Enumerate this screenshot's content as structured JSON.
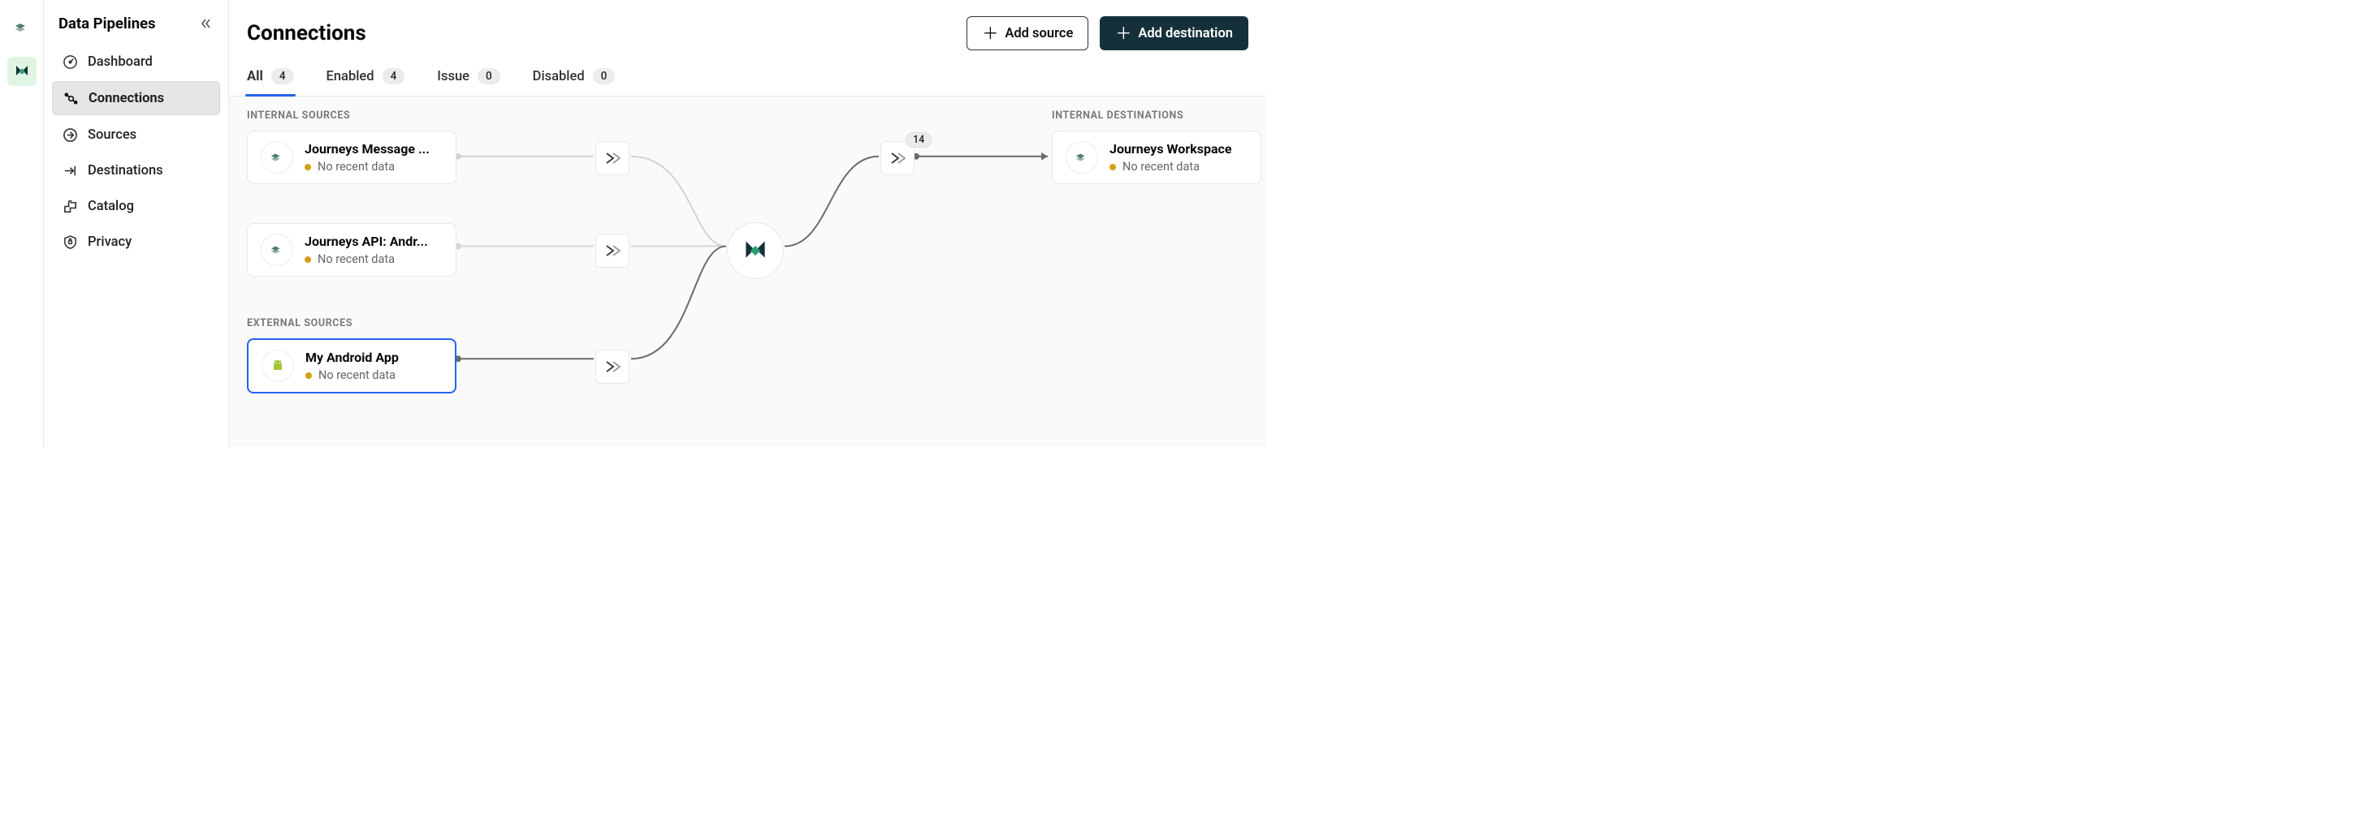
{
  "sidebar": {
    "title": "Data Pipelines",
    "nav": [
      {
        "label": "Dashboard"
      },
      {
        "label": "Connections"
      },
      {
        "label": "Sources"
      },
      {
        "label": "Destinations"
      },
      {
        "label": "Catalog"
      },
      {
        "label": "Privacy"
      }
    ]
  },
  "header": {
    "title": "Connections",
    "add_source": "Add source",
    "add_destination": "Add destination"
  },
  "tabs": {
    "all": {
      "label": "All",
      "count": "4"
    },
    "enabled": {
      "label": "Enabled",
      "count": "4"
    },
    "issue": {
      "label": "Issue",
      "count": "0"
    },
    "disabled": {
      "label": "Disabled",
      "count": "0"
    }
  },
  "graph": {
    "internal_sources_label": "INTERNAL SOURCES",
    "external_sources_label": "EXTERNAL SOURCES",
    "internal_destinations_label": "INTERNAL DESTINATIONS",
    "sources": {
      "s1": {
        "title": "Journeys Message ...",
        "status": "No recent data"
      },
      "s2": {
        "title": "Journeys API: Andr...",
        "status": "No recent data"
      },
      "s3": {
        "title": "My Android App",
        "status": "No recent data"
      }
    },
    "destinations": {
      "d1": {
        "title": "Journeys Workspace",
        "status": "No recent data"
      }
    },
    "right_filter_count": "14"
  }
}
